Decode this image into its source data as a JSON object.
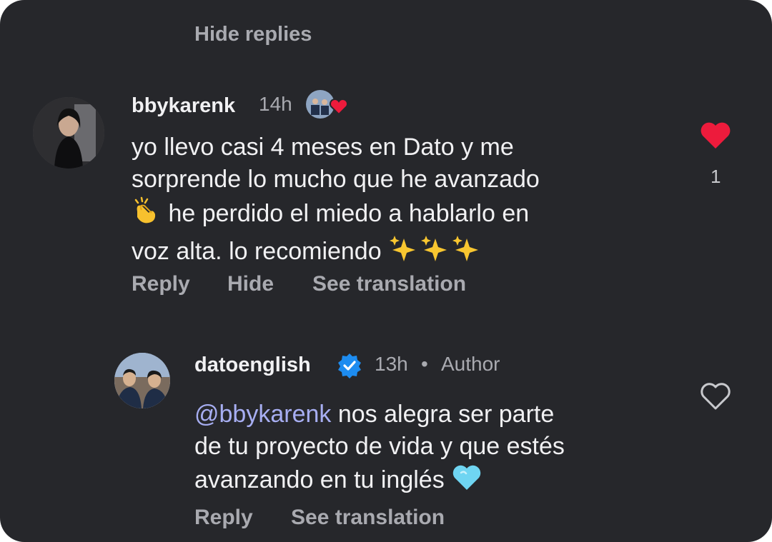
{
  "thread": {
    "hide_replies_label": "Hide replies"
  },
  "comments": [
    {
      "username": "bbykarenk",
      "time": "14h",
      "text_lines": [
        "yo llevo casi 4 meses en Dato y me",
        "sorprende lo mucho que he avanzado",
        "he perdido el miedo a hablarlo en",
        "voz alta. lo recomiendo"
      ],
      "emojis": [
        "clapping-hands",
        "sparkles",
        "sparkles",
        "sparkles"
      ],
      "liked": true,
      "like_count": "1",
      "actions": {
        "reply": "Reply",
        "hide": "Hide",
        "translate": "See translation"
      }
    },
    {
      "username": "datoenglish",
      "verified": true,
      "time": "13h",
      "separator": "•",
      "badge": "Author",
      "mention": "@bbykarenk",
      "text_lines": [
        "nos alegra ser parte",
        "de tu proyecto de vida y que estés",
        "avanzando en tu inglés"
      ],
      "emojis": [
        "light-blue-heart"
      ],
      "liked": false,
      "actions": {
        "reply": "Reply",
        "translate": "See translation"
      }
    }
  ],
  "colors": {
    "background": "#26272b",
    "text": "#f1f1f3",
    "muted": "#a9aab0",
    "like": "#ed1b3c",
    "mention": "#a7aef2",
    "verified": "#1d8cf0"
  }
}
